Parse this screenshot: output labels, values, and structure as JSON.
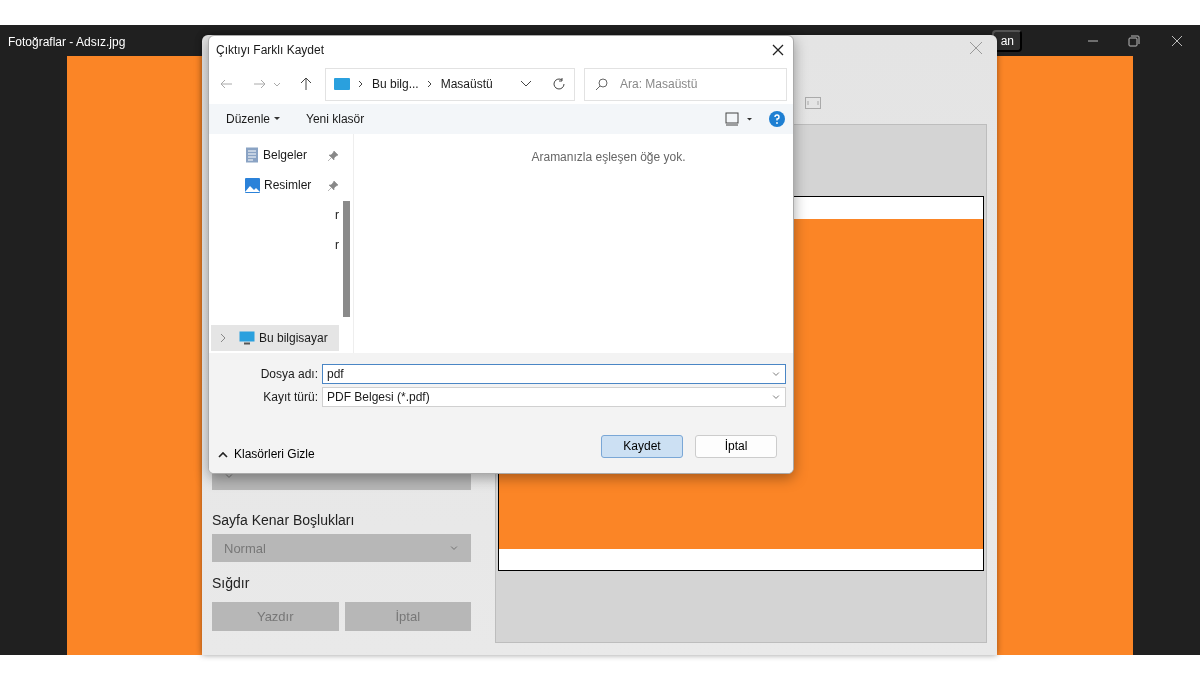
{
  "app": {
    "title": "Fotoğraflar - Adsız.jpg",
    "partial_button": "an"
  },
  "print_dialog": {
    "margin_label": "Sayfa Kenar Boşlukları",
    "margin_value": "Normal",
    "fit_label": "Sığdır",
    "buttons": [
      "Yazdır",
      "İptal"
    ]
  },
  "save_dialog": {
    "title": "Çıktıyı Farklı Kaydet",
    "breadcrumb": [
      "Bu bilg...",
      "Masaüstü"
    ],
    "search": {
      "placeholder": "Ara: Masaüstü"
    },
    "toolbar": [
      "Düzenle",
      "Yeni klasör"
    ],
    "nav_items": [
      {
        "label": "Belgeler",
        "kind": "pinned",
        "selected": false
      },
      {
        "label": "Resimler",
        "kind": "pinned",
        "selected": false
      },
      {
        "label": "r",
        "kind": "clipped",
        "selected": false
      },
      {
        "label": "r",
        "kind": "clipped",
        "selected": false
      },
      {
        "label": "Bu bilgisayar",
        "kind": "root",
        "selected": true
      }
    ],
    "empty_message": "Aramanızla eşleşen öğe yok.",
    "fields": [
      {
        "label": "Dosya adı:",
        "value": "pdf",
        "focused": true
      },
      {
        "label": "Kayıt türü:",
        "value": "PDF Belgesi (*.pdf)",
        "focused": false
      }
    ],
    "hide_folders": "Klasörleri Gizle",
    "buttons": [
      {
        "label": "Kaydet",
        "default": true
      },
      {
        "label": "İptal",
        "default": false
      }
    ]
  }
}
